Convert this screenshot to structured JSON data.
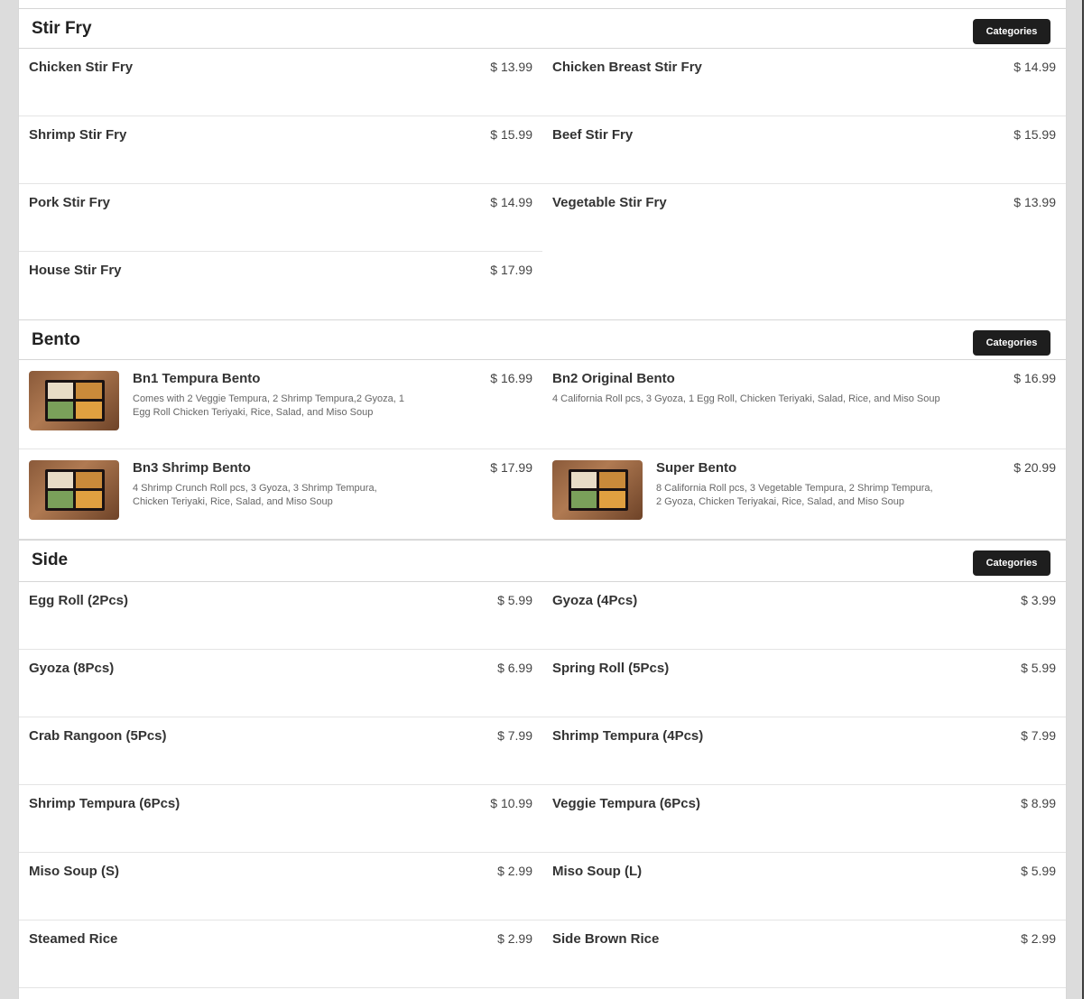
{
  "sections": [
    {
      "title": "Stir Fry",
      "button": "Categories",
      "items": [
        {
          "name": "Chicken Stir Fry",
          "price": "$ 13.99"
        },
        {
          "name": "Chicken Breast Stir Fry",
          "price": "$ 14.99"
        },
        {
          "name": "Shrimp Stir Fry",
          "price": "$ 15.99"
        },
        {
          "name": "Beef Stir Fry",
          "price": "$ 15.99"
        },
        {
          "name": "Pork Stir Fry",
          "price": "$ 14.99"
        },
        {
          "name": "Vegetable Stir Fry",
          "price": "$ 13.99"
        },
        {
          "name": "House Stir Fry",
          "price": "$ 17.99"
        }
      ]
    },
    {
      "title": "Bento",
      "button": "Categories",
      "items": [
        {
          "name": "Bn1 Tempura Bento",
          "price": "$ 16.99",
          "desc": "Comes with 2 Veggie Tempura, 2 Shrimp Tempura,2 Gyoza, 1 Egg Roll Chicken Teriyaki, Rice, Salad, and Miso Soup"
        },
        {
          "name": "Bn2 Original Bento",
          "price": "$ 16.99",
          "desc": "4 California Roll pcs, 3 Gyoza, 1 Egg Roll, Chicken Teriyaki, Salad, Rice, and Miso Soup"
        },
        {
          "name": "Bn3 Shrimp Bento",
          "price": "$ 17.99",
          "desc": "4 Shrimp Crunch Roll pcs, 3 Gyoza, 3 Shrimp Tempura, Chicken Teriyaki, Rice, Salad, and Miso Soup"
        },
        {
          "name": "Super Bento",
          "price": "$ 20.99",
          "desc": "8 California Roll pcs, 3 Vegetable Tempura, 2 Shrimp Tempura, 2 Gyoza, Chicken Teriyakai, Rice, Salad, and Miso Soup"
        }
      ]
    },
    {
      "title": "Side",
      "button": "Categories",
      "items": [
        {
          "name": "Egg Roll (2Pcs)",
          "price": "$ 5.99"
        },
        {
          "name": "Gyoza (4Pcs)",
          "price": "$ 3.99"
        },
        {
          "name": "Gyoza (8Pcs)",
          "price": "$ 6.99"
        },
        {
          "name": "Spring Roll (5Pcs)",
          "price": "$ 5.99"
        },
        {
          "name": "Crab Rangoon (5Pcs)",
          "price": "$ 7.99"
        },
        {
          "name": "Shrimp Tempura (4Pcs)",
          "price": "$ 7.99"
        },
        {
          "name": "Shrimp Tempura (6Pcs)",
          "price": "$ 10.99"
        },
        {
          "name": "Veggie Tempura (6Pcs)",
          "price": "$ 8.99"
        },
        {
          "name": "Miso Soup (S)",
          "price": "$ 2.99"
        },
        {
          "name": "Miso Soup (L)",
          "price": "$ 5.99"
        },
        {
          "name": "Steamed Rice",
          "price": "$ 2.99"
        },
        {
          "name": "Side Brown Rice",
          "price": "$ 2.99"
        }
      ]
    }
  ]
}
